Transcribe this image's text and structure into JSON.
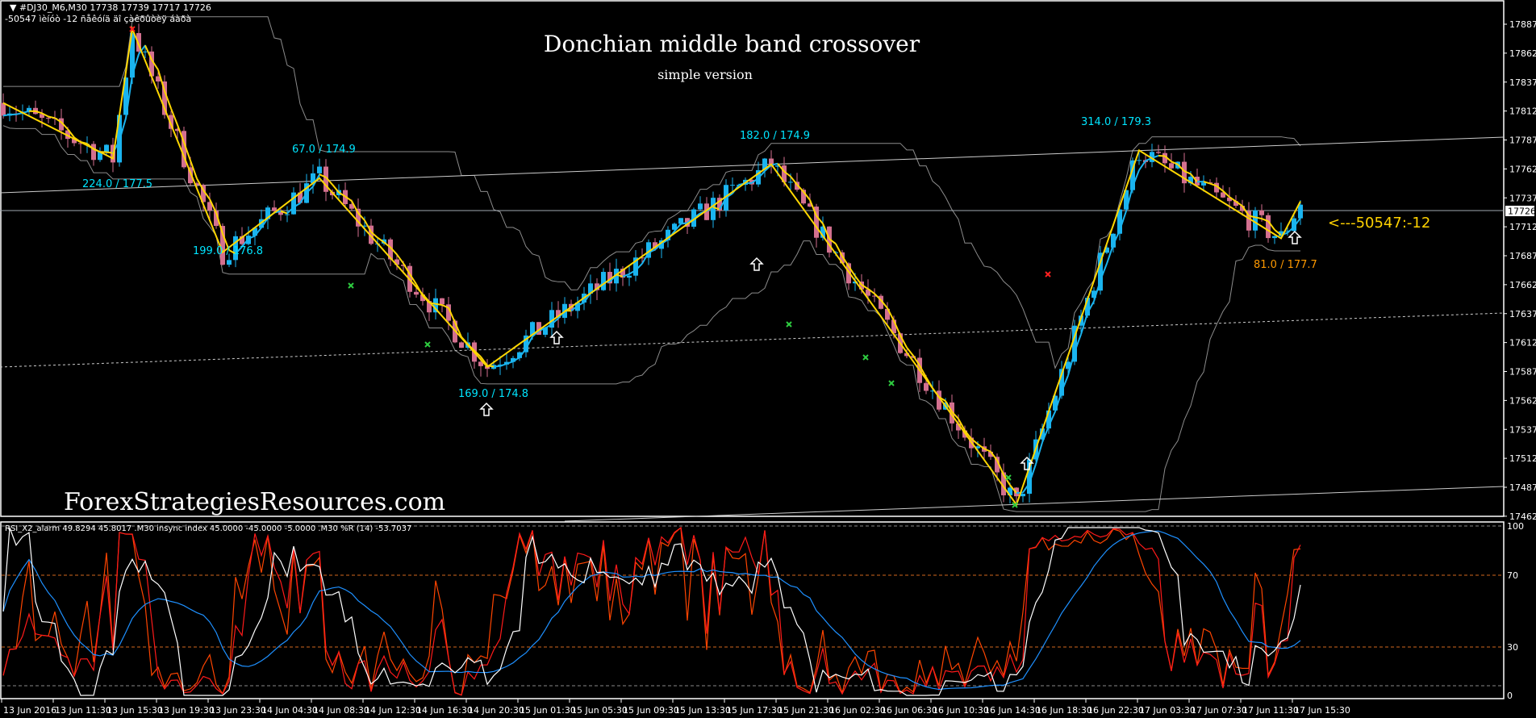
{
  "header": {
    "symbol_line": "▼ #DJ30_M6,M30  17738 17739 17717 17726",
    "info_line": "-50547 ìèíóò -12 ñåêóíä äî çàêðûòèÿ áàðà"
  },
  "title": "Donchian middle band crossover",
  "subtitle": "simple version",
  "watermark": "ForexStrategiesResources.com",
  "countdown_label": "<---50547:-12",
  "current_price": "17726",
  "price_axis": [
    "17887",
    "17862",
    "17837",
    "17812",
    "17787",
    "17762",
    "17737",
    "17712",
    "17687",
    "17662",
    "17637",
    "17612",
    "17587",
    "17562",
    "17537",
    "17512",
    "17487",
    "17462"
  ],
  "time_axis": [
    "13 Jun 2016",
    "13 Jun 11:30",
    "13 Jun 15:30",
    "13 Jun 19:30",
    "13 Jun 23:30",
    "14 Jun 04:30",
    "14 Jun 08:30",
    "14 Jun 12:30",
    "14 Jun 16:30",
    "14 Jun 20:30",
    "15 Jun 01:30",
    "15 Jun 05:30",
    "15 Jun 09:30",
    "15 Jun 13:30",
    "15 Jun 17:30",
    "15 Jun 21:30",
    "16 Jun 02:30",
    "16 Jun 06:30",
    "16 Jun 10:30",
    "16 Jun 14:30",
    "16 Jun 18:30",
    "16 Jun 22:30",
    "17 Jun 03:30",
    "17 Jun 07:30",
    "17 Jun 11:30",
    "17 Jun 15:30"
  ],
  "zigzag_labels": [
    {
      "text": "224.0 / 177.5",
      "color": "#00e5ff"
    },
    {
      "text": "67.0 / 174.9",
      "color": "#00e5ff"
    },
    {
      "text": "199.0 / 176.8",
      "color": "#00e5ff"
    },
    {
      "text": "169.0 / 174.8",
      "color": "#00e5ff"
    },
    {
      "text": "182.0 / 174.9",
      "color": "#00e5ff"
    },
    {
      "text": "314.0 / 179.3",
      "color": "#00e5ff"
    },
    {
      "text": "81.0 / 177.7",
      "color": "#ff9900"
    }
  ],
  "indicator": {
    "header": "RSI_X2_alarm 49.8294 45.8017 .M30 insync index 45.0000 -45.0000 -5.0000 .M30 %R (14) -53.7037",
    "axis": [
      "100",
      "70",
      "30",
      "0"
    ]
  },
  "chart_data": {
    "type": "candlestick",
    "symbol": "#DJ30_M6",
    "timeframe": "M30",
    "ylim": [
      17450,
      17900
    ],
    "zigzag_pivots": [
      {
        "bar": 0,
        "price": 17819
      },
      {
        "bar": 17,
        "price": 17771
      },
      {
        "bar": 20,
        "price": 17883
      },
      {
        "bar": 34,
        "price": 17690
      },
      {
        "bar": 49,
        "price": 17754
      },
      {
        "bar": 75,
        "price": 17591
      },
      {
        "bar": 119,
        "price": 17766
      },
      {
        "bar": 157,
        "price": 17472
      },
      {
        "bar": 176,
        "price": 17778
      },
      {
        "bar": 198,
        "price": 17702
      },
      {
        "bar": 201,
        "price": 17734
      }
    ],
    "colors": {
      "bull": "#1ab4ef",
      "bear": "#d3708f",
      "zigzag": "#ffd700",
      "band": "#8c8c8c"
    }
  }
}
